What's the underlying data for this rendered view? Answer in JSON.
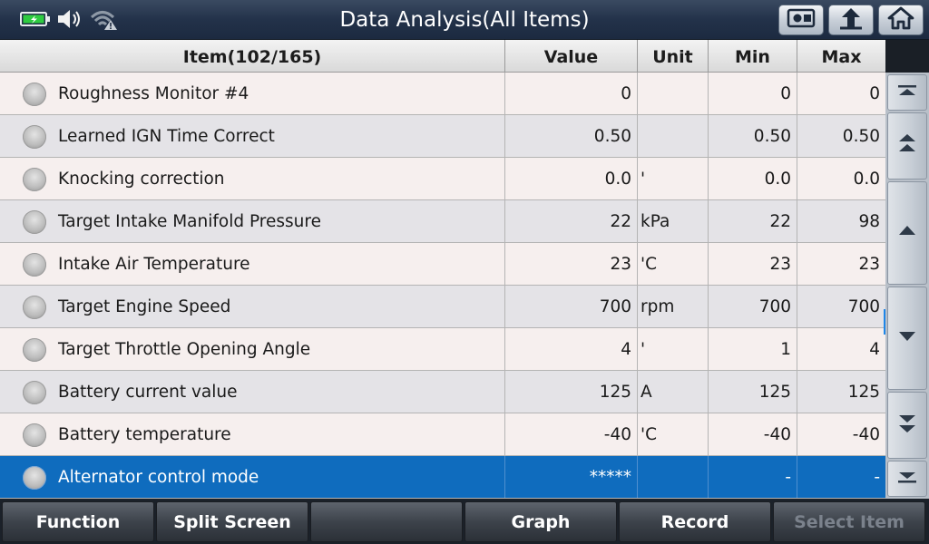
{
  "header": {
    "title": "Data Analysis(All Items)",
    "icons": [
      "battery-charging-icon",
      "speaker-icon",
      "wifi-warning-icon",
      "screenshot-icon",
      "back-up-icon",
      "home-icon"
    ]
  },
  "table": {
    "columns": {
      "item": "Item(102/165)",
      "value": "Value",
      "unit": "Unit",
      "min": "Min",
      "max": "Max"
    },
    "rows": [
      {
        "name": "Roughness Monitor #4",
        "value": "0",
        "unit": "",
        "min": "0",
        "max": "0"
      },
      {
        "name": "Learned IGN Time Correct",
        "value": "0.50",
        "unit": "",
        "min": "0.50",
        "max": "0.50"
      },
      {
        "name": "Knocking correction",
        "value": "0.0",
        "unit": "'",
        "min": "0.0",
        "max": "0.0"
      },
      {
        "name": "Target Intake Manifold Pressure",
        "value": "22",
        "unit": "kPa",
        "min": "22",
        "max": "98"
      },
      {
        "name": "Intake Air Temperature",
        "value": "23",
        "unit": "'C",
        "min": "23",
        "max": "23"
      },
      {
        "name": "Target Engine Speed",
        "value": "700",
        "unit": "rpm",
        "min": "700",
        "max": "700"
      },
      {
        "name": "Target Throttle Opening Angle",
        "value": "4",
        "unit": "'",
        "min": "1",
        "max": "4"
      },
      {
        "name": "Battery current value",
        "value": "125",
        "unit": "A",
        "min": "125",
        "max": "125"
      },
      {
        "name": "Battery temperature",
        "value": "-40",
        "unit": "'C",
        "min": "-40",
        "max": "-40"
      },
      {
        "name": "Alternator control mode",
        "value": "*****",
        "unit": "",
        "min": "-",
        "max": "-"
      }
    ],
    "selected_index": 9
  },
  "scroll_buttons": [
    "scroll-top-icon",
    "page-up-icon",
    "line-up-icon",
    "line-down-icon",
    "page-down-icon",
    "scroll-bottom-icon"
  ],
  "footer": {
    "buttons": [
      {
        "label": "Function",
        "enabled": true
      },
      {
        "label": "Split Screen",
        "enabled": true
      },
      {
        "label": "",
        "enabled": true
      },
      {
        "label": "Graph",
        "enabled": true
      },
      {
        "label": "Record",
        "enabled": true
      },
      {
        "label": "Select Item",
        "enabled": false
      }
    ]
  },
  "colors": {
    "selected_row": "#0f6cbe",
    "battery": "#2ecc40",
    "scroll_indicator": "#1f86e8"
  }
}
